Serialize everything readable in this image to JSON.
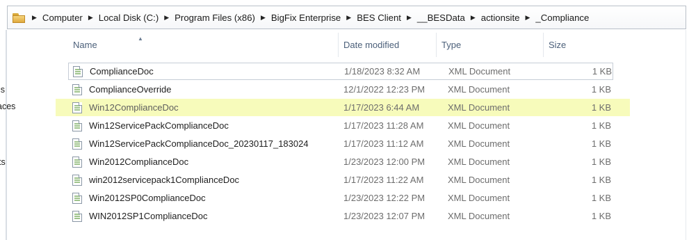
{
  "address_bar": {
    "crumbs": [
      "Computer",
      "Local Disk (C:)",
      "Program Files (x86)",
      "BigFix Enterprise",
      "BES Client",
      "__BESData",
      "actionsite",
      "_Compliance"
    ]
  },
  "left_nav": {
    "items": [
      "ls",
      "aces",
      "ts"
    ]
  },
  "columns": {
    "name": "Name",
    "date": "Date modified",
    "type": "Type",
    "size": "Size"
  },
  "files": [
    {
      "name": "ComplianceDoc",
      "date": "1/18/2023 8:32 AM",
      "type": "XML Document",
      "size": "1 KB"
    },
    {
      "name": "ComplianceOverride",
      "date": "12/1/2022 12:23 PM",
      "type": "XML Document",
      "size": "1 KB"
    },
    {
      "name": "Win12ComplianceDoc",
      "date": "1/17/2023 6:44 AM",
      "type": "XML Document",
      "size": "1 KB"
    },
    {
      "name": "Win12ServicePackComplianceDoc",
      "date": "1/17/2023 11:28 AM",
      "type": "XML Document",
      "size": "1 KB"
    },
    {
      "name": "Win12ServicePackComplianceDoc_20230117_183024",
      "date": "1/17/2023 11:12 AM",
      "type": "XML Document",
      "size": "1 KB"
    },
    {
      "name": "Win2012ComplianceDoc",
      "date": "1/23/2023 12:00 PM",
      "type": "XML Document",
      "size": "1 KB"
    },
    {
      "name": "win2012servicepack1ComplianceDoc",
      "date": "1/17/2023 11:22 AM",
      "type": "XML Document",
      "size": "1 KB"
    },
    {
      "name": "Win2012SP0ComplianceDoc",
      "date": "1/23/2023 12:22 PM",
      "type": "XML Document",
      "size": "1 KB"
    },
    {
      "name": "WIN2012SP1ComplianceDoc",
      "date": "1/23/2023 12:07 PM",
      "type": "XML Document",
      "size": "1 KB"
    }
  ],
  "highlight_color": "#f7fbbb",
  "icons": {
    "folder": "folder-icon",
    "file": "xml-file-icon",
    "breadcrumb_sep": "chevron-right-icon",
    "sort": "sort-ascending-icon"
  }
}
